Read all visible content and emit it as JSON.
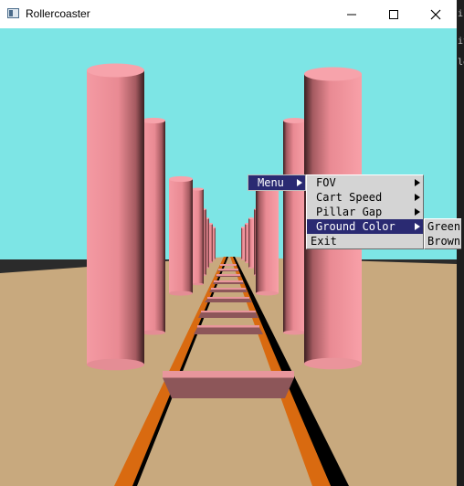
{
  "window": {
    "title": "Rollercoaster",
    "controls": {
      "minimize": "minimize-icon",
      "maximize": "maximize-icon",
      "close": "close-icon"
    }
  },
  "scene": {
    "sky_color": "#7de5e5",
    "ground_color": "#c8a97e",
    "pillar_color": "#f0919a",
    "rail_color": "#d96a10",
    "tie_color": "#c47a7e"
  },
  "menu": {
    "root_label": "Menu",
    "items": [
      {
        "label": "FOV",
        "has_submenu": true
      },
      {
        "label": "Cart Speed",
        "has_submenu": true
      },
      {
        "label": "Pillar Gap",
        "has_submenu": true
      },
      {
        "label": "Ground Color",
        "has_submenu": true,
        "active": true
      },
      {
        "label": "Exit",
        "has_submenu": false
      }
    ],
    "ground_color_options": [
      "Green",
      "Brown"
    ]
  },
  "background_app_fragments": [
    "ic",
    "it",
    "lo"
  ]
}
